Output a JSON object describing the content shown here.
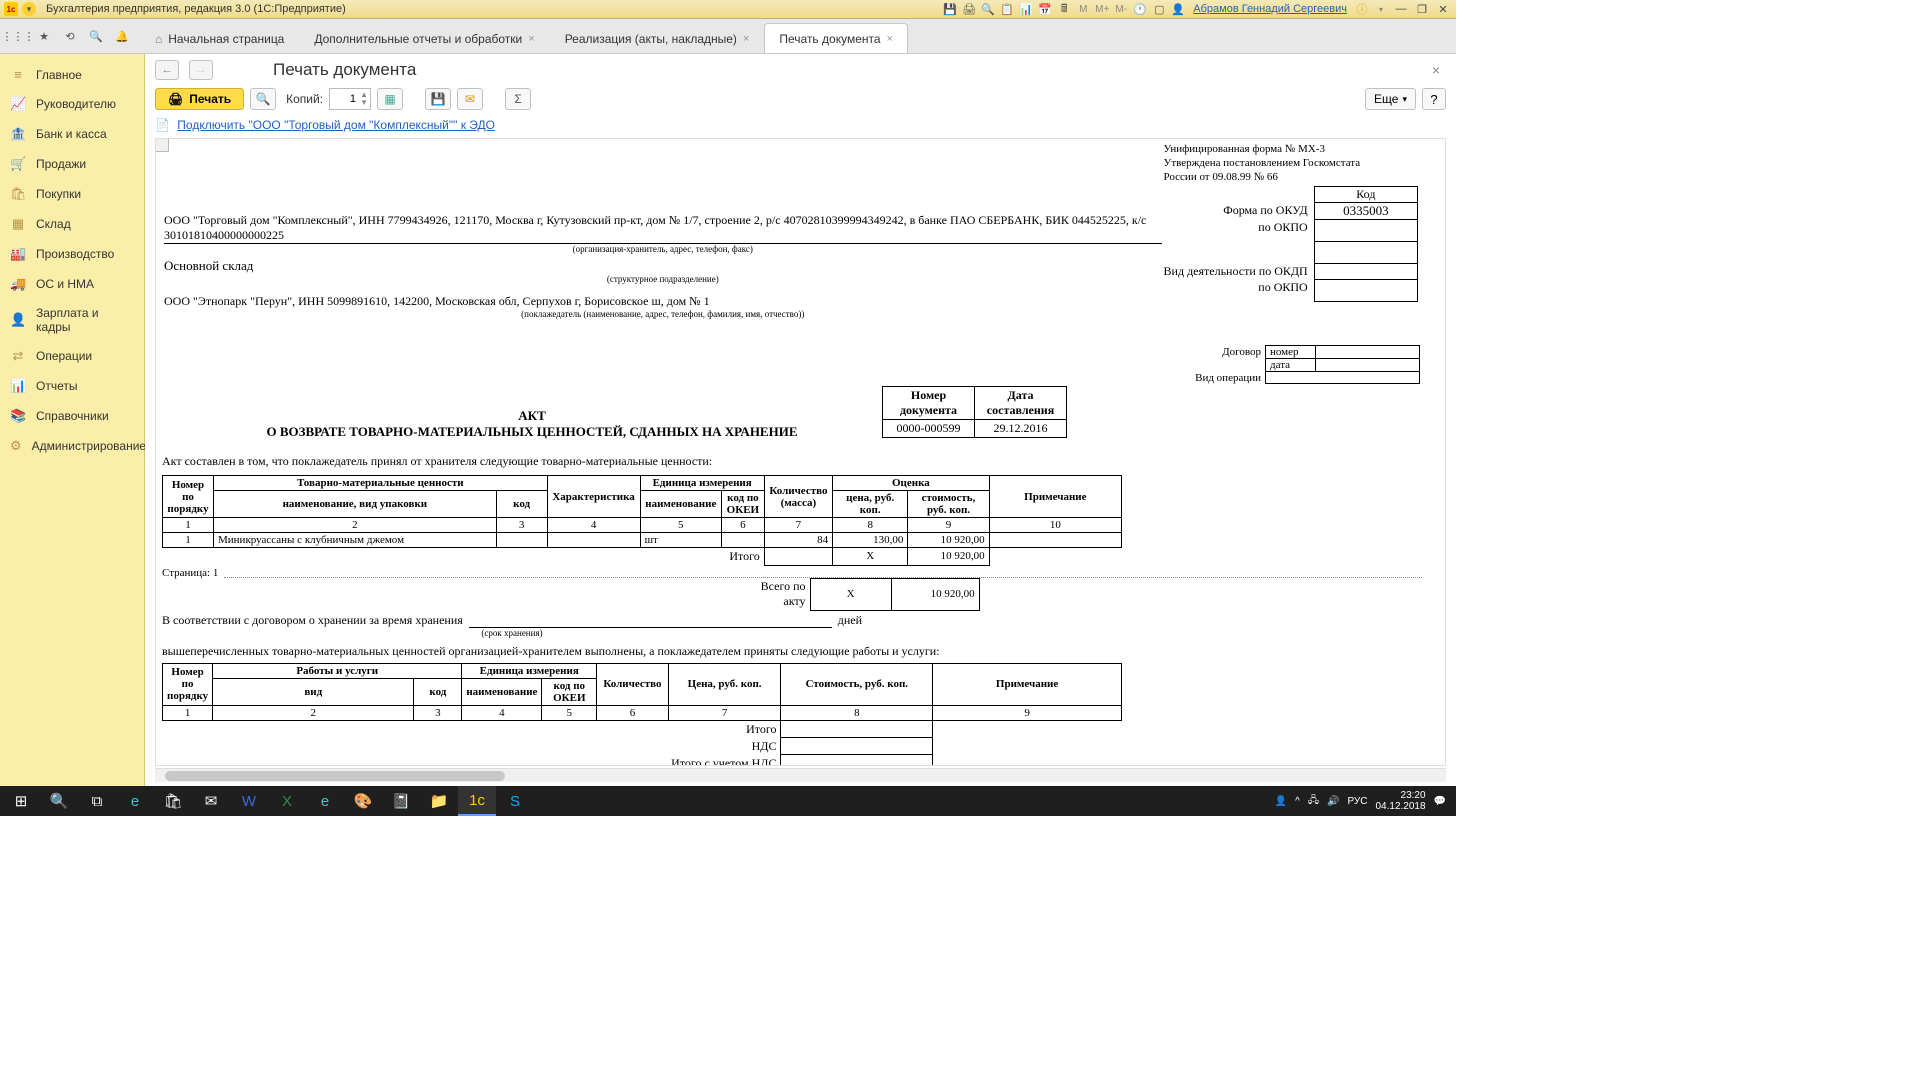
{
  "titlebar": {
    "app_title": "Бухгалтерия предприятия, редакция 3.0  (1С:Предприятие)",
    "user": "Абрамов Геннадий Сергеевич"
  },
  "tabs": {
    "home": "Начальная страница",
    "t1": "Дополнительные отчеты и обработки",
    "t2": "Реализация (акты, накладные)",
    "t3": "Печать документа"
  },
  "sidebar": {
    "items": [
      {
        "icon": "≡",
        "label": "Главное"
      },
      {
        "icon": "📈",
        "label": "Руководителю"
      },
      {
        "icon": "🏦",
        "label": "Банк и касса"
      },
      {
        "icon": "🛒",
        "label": "Продажи"
      },
      {
        "icon": "🛍",
        "label": "Покупки"
      },
      {
        "icon": "▦",
        "label": "Склад"
      },
      {
        "icon": "🏭",
        "label": "Производство"
      },
      {
        "icon": "🚚",
        "label": "ОС и НМА"
      },
      {
        "icon": "👤",
        "label": "Зарплата и кадры"
      },
      {
        "icon": "⇄",
        "label": "Операции"
      },
      {
        "icon": "📊",
        "label": "Отчеты"
      },
      {
        "icon": "📚",
        "label": "Справочники"
      },
      {
        "icon": "⚙",
        "label": "Администрирование"
      }
    ]
  },
  "page": {
    "title": "Печать документа",
    "print_btn": "Печать",
    "copies_label": "Копий:",
    "copies_value": "1",
    "more_btn": "Еще",
    "help_btn": "?",
    "edo_link": "Подключить \"ООО \"Торговый дом \"Комплексный\"\" к ЭДО"
  },
  "doc": {
    "form_note1": "Унифицированная форма № МХ-3",
    "form_note2": "Утверждена постановлением Госкомстата",
    "form_note3": "России от 09.08.99 № 66",
    "kod_label": "Код",
    "okud_label": "Форма по ОКУД",
    "okud_value": "0335003",
    "okpo1_label": "по ОКПО",
    "okdp_label": "Вид деятельности по ОКДП",
    "okpo2_label": "по ОКПО",
    "org_line": "ООО \"Торговый дом \"Комплексный\", ИНН 7799434926, 121170, Москва г, Кутузовский пр-кт, дом № 1/7, строение 2, р/с 40702810399994349242, в банке ПАО СБЕРБАНК, БИК 044525225, к/с 30101810400000000225",
    "org_cap": "(организация-хранитель, адрес, телефон, факс)",
    "struct": "Основной склад",
    "struct_cap": "(структурное подразделение)",
    "poklad": "ООО \"Этнопарк \"Перун\", ИНН 5099891610, 142200, Московская обл, Серпухов г, Борисовское ш, дом № 1",
    "poklad_cap": "(поклажедатель (наименование, адрес, телефон, фамилия, имя, отчество))",
    "dogovor_label": "Договор",
    "dogovor_num": "номер",
    "dogovor_date": "дата",
    "vidop_label": "Вид операции",
    "numdoc_h": "Номер документа",
    "date_h": "Дата составления",
    "numdoc_v": "0000-000599",
    "date_v": "29.12.2016",
    "akt_title": "АКТ",
    "akt_title2": "О ВОЗВРАТЕ ТОВАРНО-МАТЕРИАЛЬНЫХ ЦЕННОСТЕЙ, СДАННЫХ НА ХРАНЕНИЕ",
    "akt_text": "Акт составлен в том, что поклажедатель принял от хранителя следующие товарно-материальные ценности:",
    "tbl": {
      "h_num": "Номер по порядку",
      "h_tmc": "Товарно-материальные ценности",
      "h_name": "наименование, вид упаковки",
      "h_code": "код",
      "h_char": "Характеристика",
      "h_unit": "Единица измерения",
      "h_unit_name": "наименование",
      "h_unit_okei": "код по ОКЕИ",
      "h_qty": "Количество (масса)",
      "h_val": "Оценка",
      "h_price": "цена, руб. коп.",
      "h_cost": "стоимость, руб. коп.",
      "h_note": "Примечание",
      "cols": [
        "1",
        "2",
        "3",
        "4",
        "5",
        "6",
        "7",
        "8",
        "9",
        "10"
      ],
      "row": {
        "num": "1",
        "name": "Миникруассаны с клубничным джемом",
        "unit": "шт",
        "qty": "84",
        "price": "130,00",
        "cost": "10 920,00"
      },
      "itogo": "Итого",
      "itogo_x": "Х",
      "itogo_cost": "10 920,00",
      "vsego": "Всего по акту",
      "vsego_cost": "10 920,00"
    },
    "page_label": "Страница:",
    "page_num": "1",
    "storage_line1": "В соответствии с договором о хранении за время хранения",
    "storage_days": "дней",
    "storage_cap": "(срок хранения)",
    "svc_intro": "вышеперечисленных товарно-материальных ценностей организацией-хранителем выполнены, а поклажедателем приняты следующие работы и услуги:",
    "svc": {
      "h_num": "Номер по порядку",
      "h_work": "Работы и услуги",
      "h_vid": "вид",
      "h_code": "код",
      "h_unit": "Единица измерения",
      "h_unit_name": "наименование",
      "h_unit_okei": "код по ОКЕИ",
      "h_qty": "Количество",
      "h_price": "Цена, руб. коп.",
      "h_cost": "Стоимость, руб. коп.",
      "h_note": "Примечание",
      "cols": [
        "1",
        "2",
        "3",
        "4",
        "5",
        "6",
        "7",
        "8",
        "9"
      ],
      "itogo": "Итого",
      "nds": "НДС",
      "itogo_nds": "Итого с учетом НДС"
    }
  },
  "taskbar": {
    "time": "23:20",
    "date": "04.12.2018"
  }
}
